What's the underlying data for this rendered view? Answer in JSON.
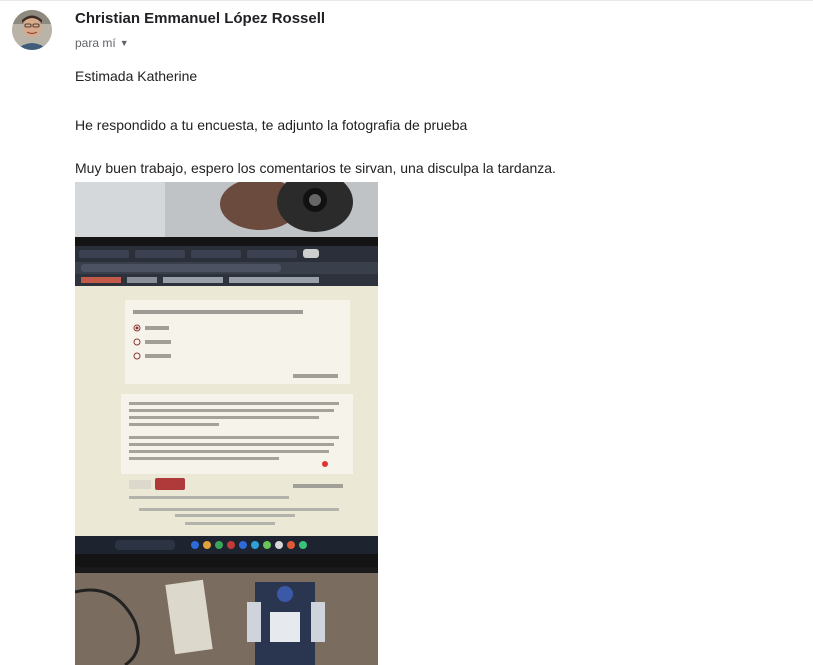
{
  "email": {
    "sender_name": "Christian Emmanuel López Rossell",
    "recipient_label": "para mí",
    "recipient_menu_icon": "chevron-down-icon",
    "greeting": "Estimada Katherine",
    "paragraph_1": "He respondido a tu encuesta, te adjunto la fotografia de prueba",
    "paragraph_2": "Muy buen trabajo, espero los comentarios te sirvan, una disculpa la tardanza."
  },
  "colors": {
    "sender_text": "#202124",
    "secondary_text": "#5f6368",
    "submit_button": "#b03a3a"
  }
}
